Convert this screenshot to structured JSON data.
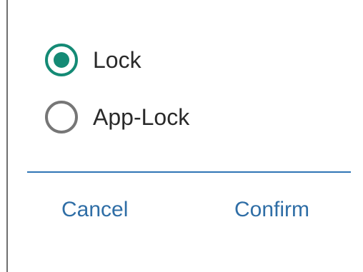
{
  "dialog": {
    "options": [
      {
        "label": "Lock",
        "checked": true
      },
      {
        "label": "App-Lock",
        "checked": false
      }
    ],
    "cancel_label": "Cancel",
    "confirm_label": "Confirm"
  },
  "colors": {
    "radio_checked": "#148a75",
    "radio_unchecked": "#767676",
    "action_text": "#2f6ea6",
    "divider": "#2f75b5"
  },
  "icons": {
    "radio_checked": "radio-checked-icon",
    "radio_unchecked": "radio-unchecked-icon"
  }
}
